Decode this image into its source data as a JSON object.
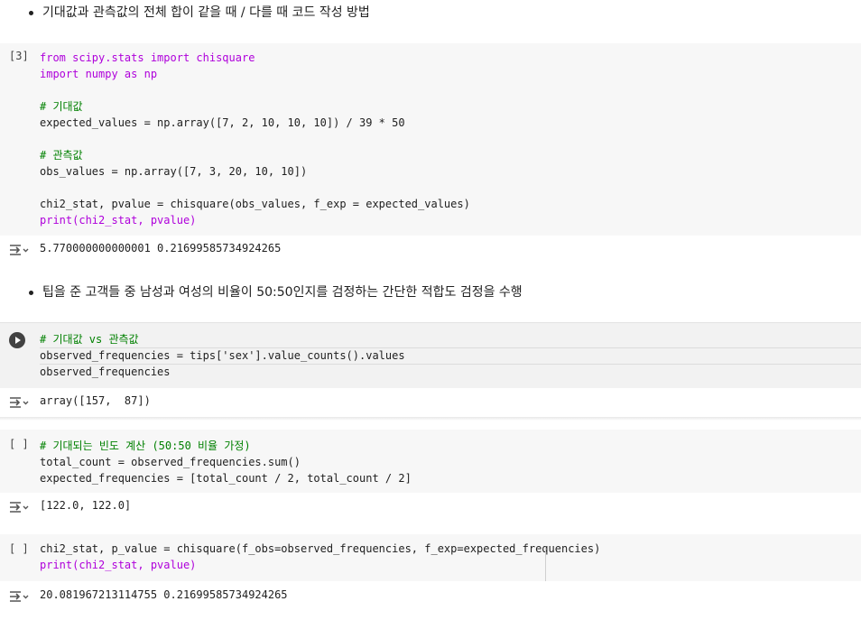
{
  "text_cells": [
    {
      "text": "기대값과 관측값의 전체 합이 같을 때 / 다를 때 코드 작성 방법"
    },
    {
      "text": "팁을 준 고객들 중 남성과 여성의 비율이 50:50인지를 검정하는 간단한 적합도 검정을 수행"
    }
  ],
  "cells": [
    {
      "label": "[3]",
      "lines": [
        "from scipy.stats import chisquare",
        "import numpy as np",
        "",
        "# 기대값",
        "expected_values = np.array([7, 2, 10, 10, 10]) / 39 * 50",
        "",
        "# 관측값",
        "obs_values = np.array([7, 3, 20, 10, 10])",
        "",
        "chi2_stat, pvalue = chisquare(obs_values, f_exp = expected_values)",
        "print(chi2_stat, pvalue)"
      ],
      "output": "5.770000000000001 0.21699585734924265"
    },
    {
      "label": "",
      "lines": [
        "# 기대값 vs 관측값",
        "observed_frequencies = tips['sex'].value_counts().values",
        "observed_frequencies"
      ],
      "output": "array([157,  87])"
    },
    {
      "label": "[ ]",
      "lines": [
        "# 기대되는 빈도 계산 (50:50 비율 가정)",
        "total_count = observed_frequencies.sum()",
        "expected_frequencies = [total_count / 2, total_count / 2]"
      ],
      "output": "[122.0, 122.0]"
    },
    {
      "label": "[ ]",
      "lines": [
        "chi2_stat, p_value = chisquare(f_obs=observed_frequencies, f_exp=expected_frequencies)",
        "print(chi2_stat, pvalue)"
      ],
      "output": "20.081967213114755 0.21699585734924265"
    }
  ],
  "icons": {
    "run": "play-icon",
    "output": "output-toggle-icon"
  },
  "colors": {
    "keyword": "#af00db",
    "comment": "#008000",
    "number": "#098658",
    "function": "#795e26",
    "string": "#a31515",
    "cell_bg": "#f7f7f7"
  }
}
